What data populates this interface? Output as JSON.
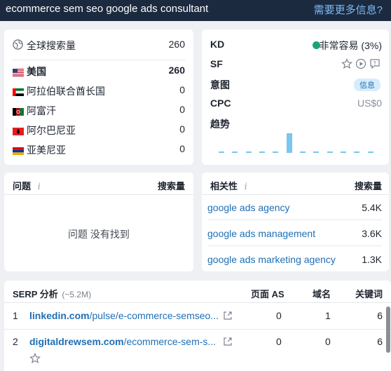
{
  "topbar": {
    "keyword": "ecommerce sem seo google ads consultant",
    "more_info": "需要更多信息?"
  },
  "volume": {
    "global_label": "全球搜索量",
    "global_value": "260",
    "countries": [
      {
        "name": "美国",
        "value": "260",
        "flag": "us"
      },
      {
        "name": "阿拉伯联合酋长国",
        "value": "0",
        "flag": "ae"
      },
      {
        "name": "阿富汗",
        "value": "0",
        "flag": "af"
      },
      {
        "name": "阿尔巴尼亚",
        "value": "0",
        "flag": "al"
      },
      {
        "name": "亚美尼亚",
        "value": "0",
        "flag": "am"
      }
    ]
  },
  "metrics": {
    "kd_label": "KD",
    "kd_value": "非常容易 (3%)",
    "kd_color": "#1aa37a",
    "sf_label": "SF",
    "intent_label": "意图",
    "intent_value": "信息",
    "cpc_label": "CPC",
    "cpc_value": "US$0",
    "trend_label": "趋势",
    "trend_values": [
      0.08,
      0.08,
      0.08,
      0.08,
      0.08,
      1.0,
      0.08,
      0.08,
      0.08,
      0.08,
      0.08,
      0.08
    ]
  },
  "questions": {
    "title": "问题",
    "volume_header": "搜索量",
    "empty_text": "问题 没有找到"
  },
  "related": {
    "title": "相关性",
    "volume_header": "搜索量",
    "items": [
      {
        "keyword": "google ads agency",
        "volume": "5.4K"
      },
      {
        "keyword": "google ads management",
        "volume": "3.6K"
      },
      {
        "keyword": "google ads marketing agency",
        "volume": "1.3K"
      }
    ]
  },
  "serp": {
    "title": "SERP 分析",
    "count": "(~5.2M)",
    "col_page_as": "页面 AS",
    "col_domains": "域名",
    "col_keywords": "关键词",
    "rows": [
      {
        "rank": "1",
        "domain": "linkedin.com",
        "path": "/pulse/e-commerce-semseo...",
        "page_as": "0",
        "domains": "1",
        "keywords": "6"
      },
      {
        "rank": "2",
        "domain": "digitaldrewsem.com",
        "path": "/ecommerce-sem-s...",
        "page_as": "0",
        "domains": "0",
        "keywords": "6"
      }
    ]
  }
}
